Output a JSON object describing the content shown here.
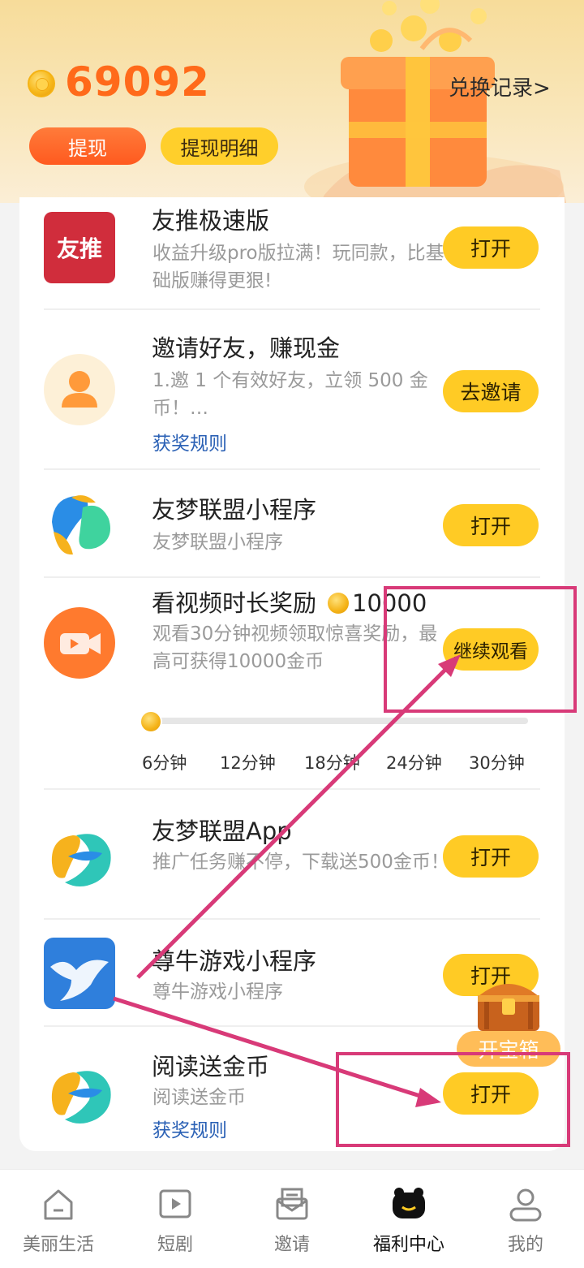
{
  "header": {
    "balance": "69092",
    "exchange_link": "兑换记录>",
    "withdraw_label": "提现",
    "withdraw_detail_label": "提现明细"
  },
  "tasks": [
    {
      "title": "友推极速版",
      "icon_text": "友推",
      "desc": "收益升级pro版拉满！玩同款，比基础版赚得更狠!",
      "action": "打开"
    },
    {
      "title": "邀请好友，赚现金",
      "desc": "1.邀 1 个有效好友，立领 500 金币！…",
      "rule": "获奖规则",
      "action": "去邀请"
    },
    {
      "title": "友梦联盟小程序",
      "desc": "友梦联盟小程序",
      "action": "打开"
    },
    {
      "title": "看视频时长奖励",
      "reward": "10000",
      "desc": "观看30分钟视频领取惊喜奖励，最高可获得10000金币",
      "action": "继续观看",
      "progress": {
        "ticks": [
          "6分钟",
          "12分钟",
          "18分钟",
          "24分钟",
          "30分钟"
        ],
        "current_fraction": 0.0
      }
    },
    {
      "title": "友梦联盟App",
      "desc": "推广任务赚不停，下载送500金币！",
      "action": "打开"
    },
    {
      "title": "尊牛游戏小程序",
      "desc": "尊牛游戏小程序",
      "action": "打开"
    },
    {
      "title": "阅读送金币",
      "desc": "阅读送金币",
      "rule": "获奖规则",
      "action": "打开"
    }
  ],
  "treasure": {
    "label": "开宝箱"
  },
  "tabbar": [
    {
      "label": "美丽生活",
      "icon": "home-icon"
    },
    {
      "label": "短剧",
      "icon": "play-icon"
    },
    {
      "label": "邀请",
      "icon": "envelope-icon"
    },
    {
      "label": "福利中心",
      "icon": "welfare-icon",
      "active": true
    },
    {
      "label": "我的",
      "icon": "profile-icon"
    }
  ],
  "colors": {
    "accent": "#ffcb25",
    "brand_orange": "#ff6a1a",
    "annotation": "#d83a78",
    "link": "#2b61b5"
  }
}
